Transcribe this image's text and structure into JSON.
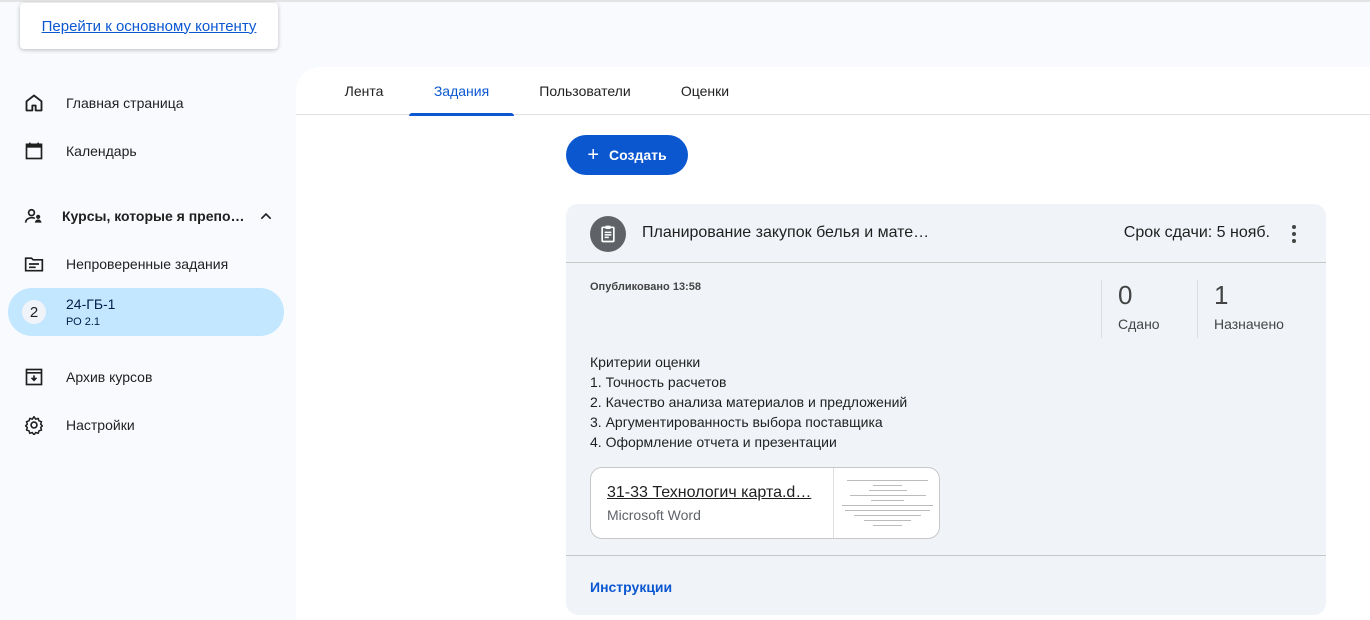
{
  "skip_link": "Перейти к основному контенту",
  "sidebar": {
    "home": "Главная страница",
    "calendar": "Календарь",
    "teaching": "Курсы, которые я препо…",
    "to_review": "Непроверенные задания",
    "course": {
      "badge": "2",
      "name": "24-ГБ-1",
      "section": "РО 2.1"
    },
    "archive": "Архив курсов",
    "settings": "Настройки"
  },
  "tabs": [
    "Лента",
    "Задания",
    "Пользователи",
    "Оценки"
  ],
  "create_label": "Создать",
  "assignment": {
    "title": "Планирование закупок белья и мате…",
    "due": "Срок сдачи: 5 нояб.",
    "published": "Опубликовано 13:58",
    "turned_in": {
      "value": "0",
      "label": "Сдано"
    },
    "assigned": {
      "value": "1",
      "label": "Назначено"
    },
    "description": [
      "Критерии оценки",
      "1. Точность расчетов",
      "2. Качество анализа материалов и предложений",
      "3. Аргументированность выбора поставщика",
      "4. Оформление отчета и презентации"
    ],
    "attachment": {
      "name": "31-33 Технологич карта.d…",
      "type": "Microsoft Word"
    },
    "instructions": "Инструкции"
  },
  "colors": {
    "accent": "#0b57d0",
    "selected": "#c2e7ff",
    "card": "#f0f4f9"
  }
}
